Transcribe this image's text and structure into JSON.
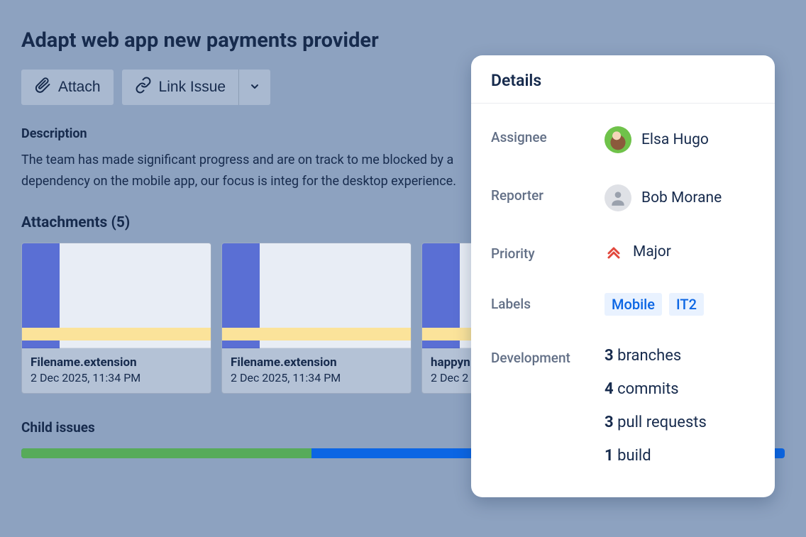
{
  "issue": {
    "title": "Adapt web app new payments provider",
    "toolbar": {
      "attach": "Attach",
      "link_issue": "Link Issue"
    },
    "description": {
      "heading": "Description",
      "text": "The team has made significant progress and are on track to me blocked by a dependency on the mobile app, our focus is integ for the desktop experience."
    },
    "attachments": {
      "heading": "Attachments (5)",
      "items": [
        {
          "name": "Filename.extension",
          "date": "2 Dec 2025, 11:34 PM"
        },
        {
          "name": "Filename.extension",
          "date": "2 Dec 2025, 11:34 PM"
        },
        {
          "name": "happyn",
          "date": "2 Dec 2"
        }
      ]
    },
    "child_issues": {
      "heading": "Child issues"
    }
  },
  "details": {
    "title": "Details",
    "rows": {
      "assignee": {
        "label": "Assignee",
        "value": "Elsa Hugo"
      },
      "reporter": {
        "label": "Reporter",
        "value": "Bob Morane"
      },
      "priority": {
        "label": "Priority",
        "value": "Major"
      },
      "labels": {
        "label": "Labels",
        "values": [
          "Mobile",
          "IT2"
        ]
      },
      "development": {
        "label": "Development",
        "items": [
          {
            "count": "3",
            "text": "branches"
          },
          {
            "count": "4",
            "text": "commits"
          },
          {
            "count": "3",
            "text": "pull requests"
          },
          {
            "count": "1",
            "text": "build"
          }
        ]
      }
    }
  }
}
